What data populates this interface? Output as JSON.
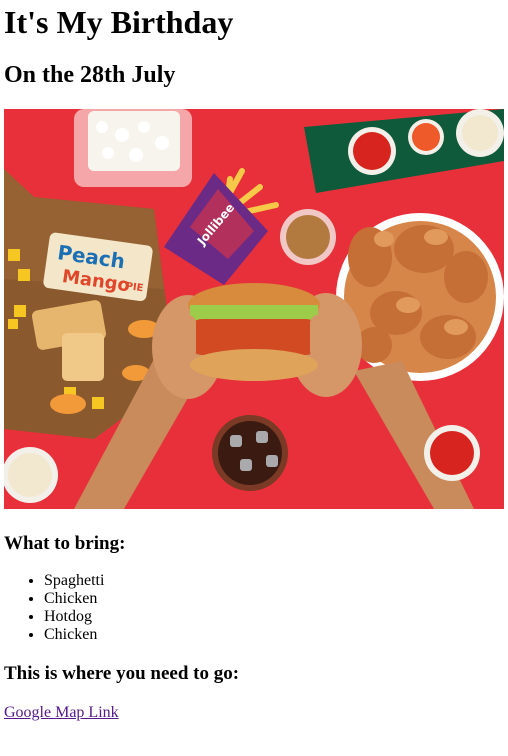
{
  "page": {
    "title": "It's My Birthday",
    "date_heading": "On the 28th July",
    "hero_image": {
      "description": "Overhead photo of fast food on a red table: hands holding a chicken burger, a bowl of fried chicken, fries, rice, dipping sauces, a soda glass and peach mango pies on a wooden board",
      "box_lettering": "Jollibee",
      "pie_label_line1": "Peach",
      "pie_label_line2": "Mango",
      "pie_label_line3": "PIE",
      "colors": {
        "table": "#e8303a",
        "tray": "#0f5a3a",
        "board": "#8a5a2e"
      }
    },
    "bring_heading": "What to bring:",
    "bring_items": [
      "Spaghetti",
      "Chicken",
      "Hotdog",
      "Chicken"
    ],
    "go_heading": "This is where you need to go:",
    "map_link_label": "Google Map Link",
    "colors": {
      "visited_link": "#551a8b"
    }
  }
}
